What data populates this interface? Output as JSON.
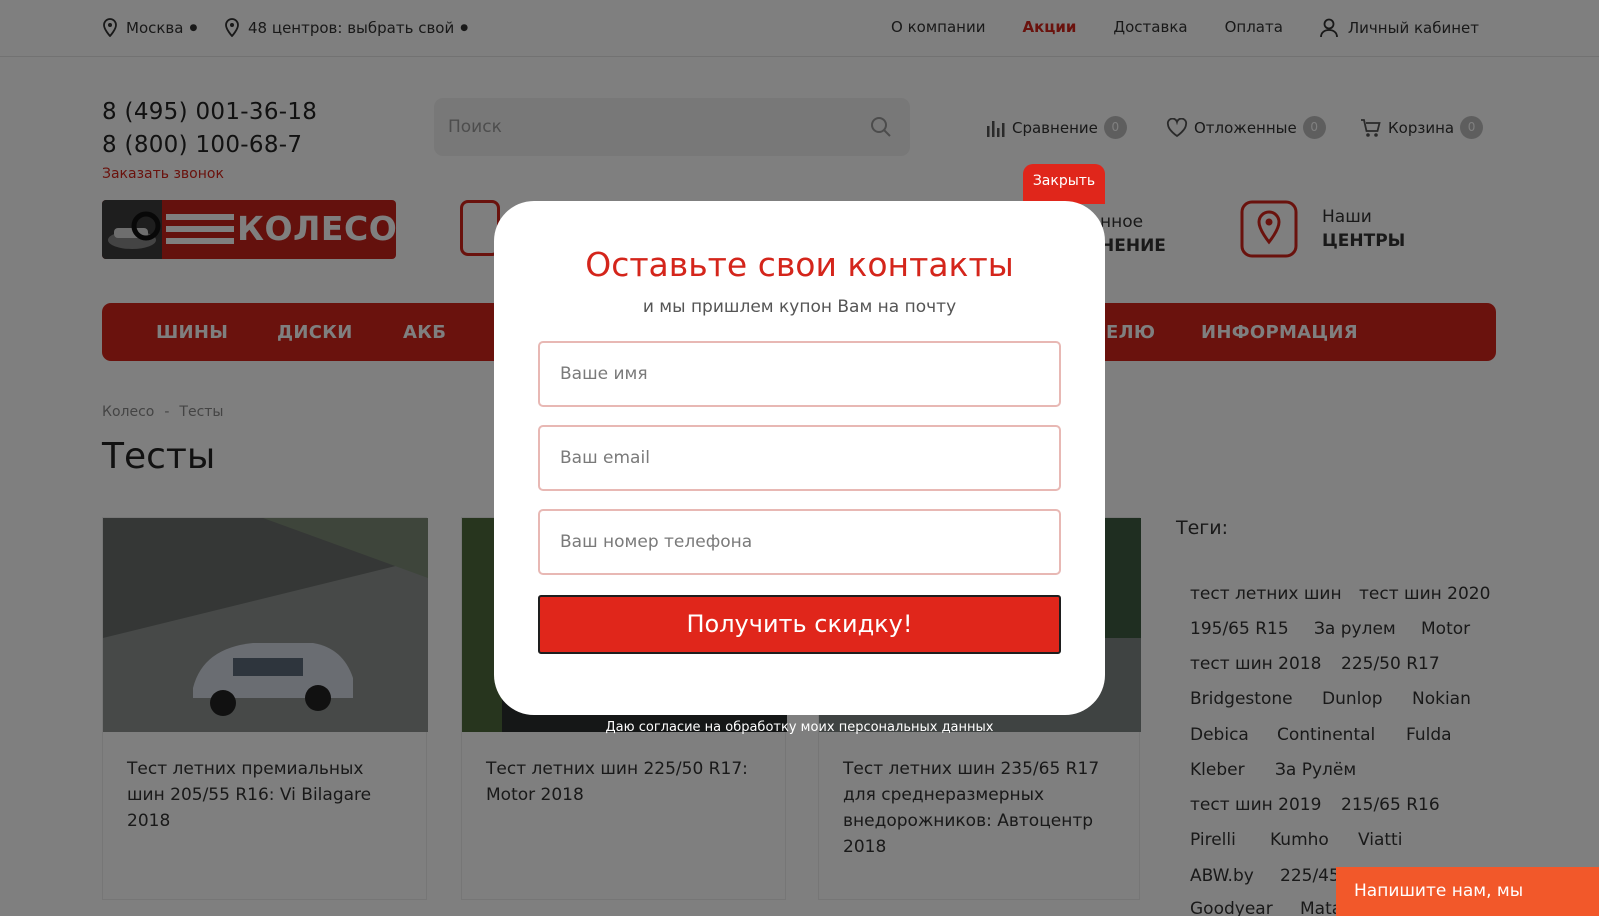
{
  "topbar": {
    "city": "Москва",
    "centers": "48 центров: выбрать свой",
    "nav": [
      "О компании",
      "Акции",
      "Доставка",
      "Оплата"
    ],
    "account": "Личный кабинет"
  },
  "header": {
    "phone1": "8 (495) 001-36-18",
    "phone2": "8 (800) 100-68-7",
    "callback": "Заказать звонок",
    "search_placeholder": "Поиск",
    "compare": {
      "label": "Сравнение",
      "count": "0"
    },
    "saved": {
      "label": "Отложенные",
      "count": "0"
    },
    "cart": {
      "label": "Корзина",
      "count": "0"
    },
    "logo_text": "КОЛЕСО",
    "service_fragment": {
      "line1": "нное",
      "line2": "НЕНИЕ"
    },
    "centers": {
      "line1": "Наши",
      "line2": "ЦЕНТРЫ"
    }
  },
  "menu": {
    "items": [
      "ШИНЫ",
      "ДИСКИ",
      "АКБ",
      "ЕЛЮ",
      "ИНФОРМАЦИЯ"
    ]
  },
  "breadcrumb": {
    "home": "Колесо",
    "sep": "-",
    "current": "Тесты"
  },
  "page_title": "Тесты",
  "cards": [
    {
      "title": "Тест летних премиальных шин 205/55 R16: Vi Bilagare 2018"
    },
    {
      "title": "Тест летних шин 225/50 R17: Motor 2018"
    },
    {
      "title": "Тест летних шин 235/65 R17 для среднеразмерных внедорожников: Автоцентр 2018"
    }
  ],
  "tags_title": "Теги:",
  "tags": [
    "тест летних шин",
    "тест шин 2020",
    "195/65 R15",
    "За рулем",
    "Motor",
    "тест шин 2018",
    "225/50 R17",
    "Bridgestone",
    "Dunlop",
    "Nokian",
    "Debica",
    "Continental",
    "Fulda",
    "Kleber",
    "За Рулём",
    "тест шин 2019",
    "215/65 R16",
    "Pirelli",
    "Kumho",
    "Viatti",
    "ABW.by",
    "225/45",
    "Goodyear",
    "Mata"
  ],
  "modal": {
    "close": "Закрыть",
    "title": "Оставьте свои контакты",
    "subtitle": "и мы пришлем купон Вам на почту",
    "name_placeholder": "Ваше имя",
    "email_placeholder": "Ваш email",
    "phone_placeholder": "Ваш номер телефона",
    "submit": "Получить скидку!",
    "consent": "Даю согласие на обработку моих персональных данных"
  },
  "chat": "Напишите нам, мы онлайн!"
}
